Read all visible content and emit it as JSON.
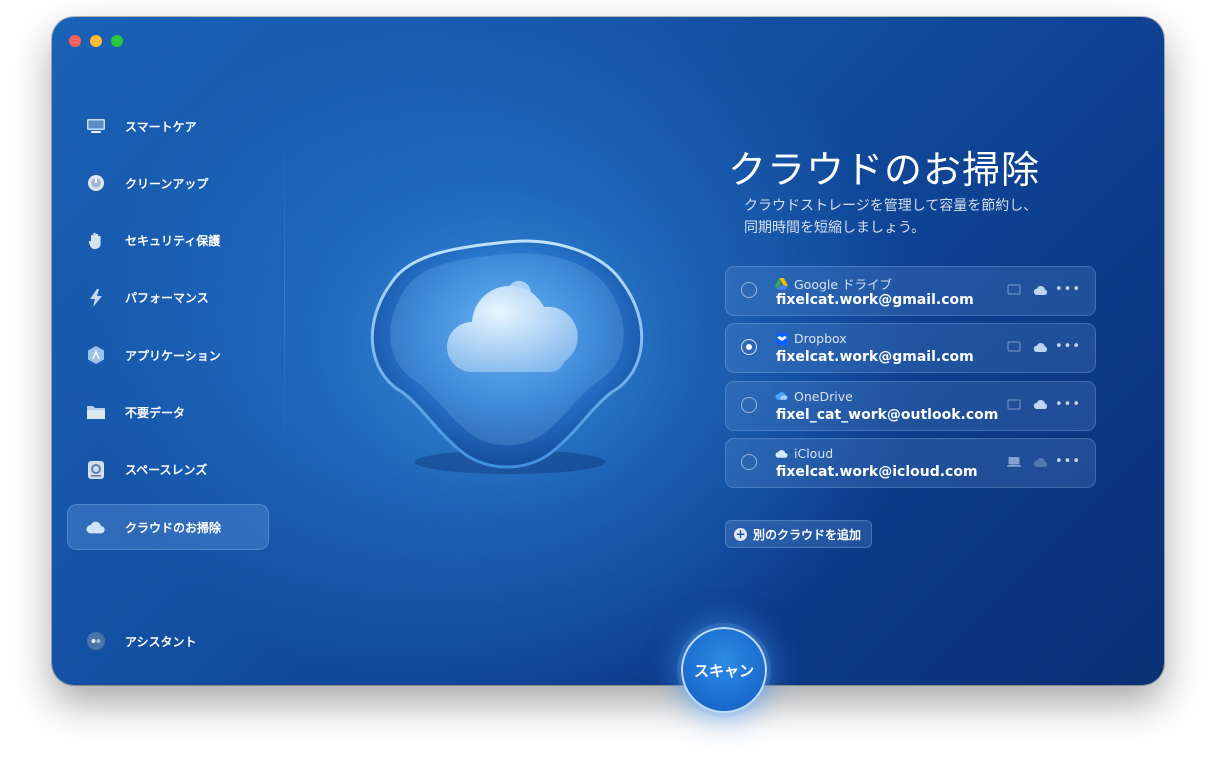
{
  "window": {
    "traffic_lights": [
      "close",
      "minimize",
      "zoom"
    ]
  },
  "sidebar": {
    "items": [
      {
        "label": "スマートケア",
        "icon": "monitor-icon"
      },
      {
        "label": "クリーンアップ",
        "icon": "disk-icon"
      },
      {
        "label": "セキュリティ保護",
        "icon": "hand-icon"
      },
      {
        "label": "パフォーマンス",
        "icon": "lightning-icon"
      },
      {
        "label": "アプリケーション",
        "icon": "apps-icon"
      },
      {
        "label": "不要データ",
        "icon": "folder-icon"
      },
      {
        "label": "スペースレンズ",
        "icon": "lens-icon"
      },
      {
        "label": "クラウドのお掃除",
        "icon": "cloud-icon",
        "active": true
      }
    ],
    "assistant_label": "アシスタント"
  },
  "main": {
    "title": "クラウドのお掃除",
    "subtitle_line1": "クラウドストレージを管理して容量を節約し、",
    "subtitle_line2": "同期時間を短縮しましょう。",
    "accounts": [
      {
        "provider": "Google ドライブ",
        "email": "fixelcat.work@gmail.com",
        "selected": false,
        "icon": "google-drive-icon"
      },
      {
        "provider": "Dropbox",
        "email": "fixelcat.work@gmail.com",
        "selected": true,
        "icon": "dropbox-icon"
      },
      {
        "provider": "OneDrive",
        "email": "fixel_cat_work@outlook.com",
        "selected": false,
        "icon": "onedrive-icon"
      },
      {
        "provider": "iCloud",
        "email": "fixelcat.work@icloud.com",
        "selected": false,
        "icon": "icloud-icon"
      }
    ],
    "add_cloud_label": "別のクラウドを追加",
    "scan_label": "スキャン"
  },
  "colors": {
    "accent": "#1c6fd0",
    "background_dark": "#0a2f74",
    "background_light": "#2c8be6"
  }
}
